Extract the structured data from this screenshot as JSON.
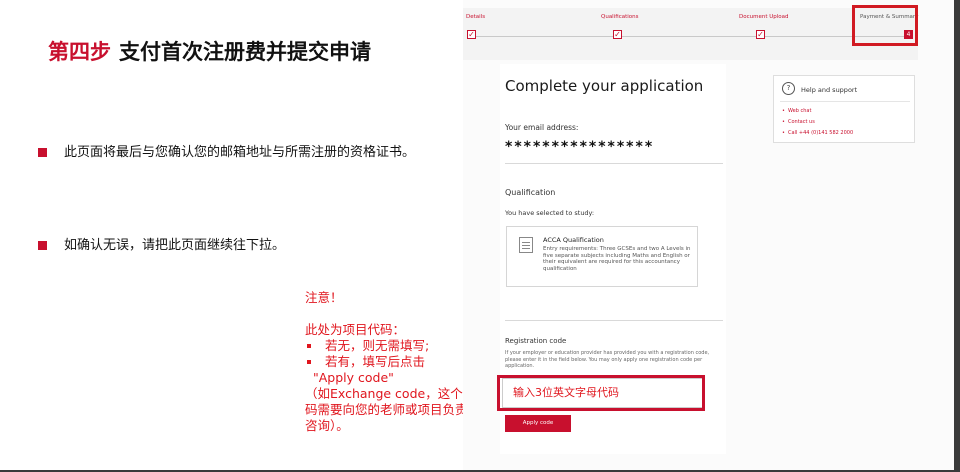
{
  "slide": {
    "title_step": "第四步",
    "title_main": "支付首次注册费并提交申请",
    "bullets": [
      "此页面将最后与您确认您的邮箱地址与所需注册的资格证书。",
      "如确认无误，请把此页面继续往下拉。"
    ],
    "note": {
      "title": "注意！",
      "intro": "此处为项目代码：",
      "items": [
        "若无，则无需填写;",
        "若有，填写后点击"
      ],
      "apply_code": "\"Apply code\"",
      "detail": "（如Exchange code，这个代码需要向您的老师或项目负责人咨询）。"
    }
  },
  "progress": {
    "steps": [
      {
        "label": "Details",
        "state": "done"
      },
      {
        "label": "Qualifications",
        "state": "done"
      },
      {
        "label": "Document Upload",
        "state": "done"
      },
      {
        "label": "Payment & Summary",
        "state": "current",
        "number": "4"
      }
    ]
  },
  "form": {
    "heading": "Complete your application",
    "email_label": "Your email address:",
    "email_value": "****************",
    "qualification_heading": "Qualification",
    "selected_label": "You have selected to study:",
    "qualification_card": {
      "title": "ACCA Qualification",
      "body": "Entry requirements: Three GCSEs and two A Levels in five separate subjects including Maths and English or their equivalent are required for this accountancy qualification"
    },
    "registration_heading": "Registration code",
    "registration_desc": "If your employer or education provider has provided you with a registration code, please enter it in the field below. You may only apply one registration code per application.",
    "code_input_placeholder": "输入3位英文字母代码",
    "apply_button": "Apply code"
  },
  "help": {
    "icon": "?",
    "title": "Help and support",
    "links": [
      "Web chat",
      "Contact us",
      "Call +44 (0)141 582 2000"
    ]
  },
  "colors": {
    "accent": "#c8102e",
    "note_red": "#e0161e"
  }
}
